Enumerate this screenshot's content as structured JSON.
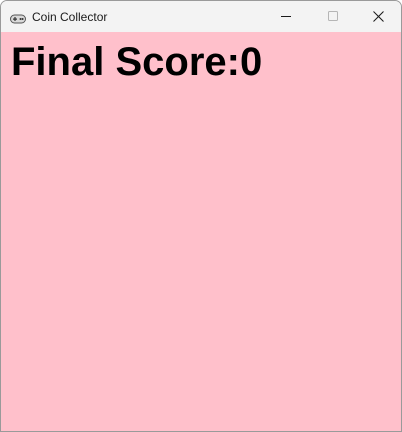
{
  "window": {
    "title": "Coin Collector",
    "app_icon": "gamepad-icon",
    "controls": {
      "minimize": "minimize-icon",
      "maximize": "maximize-icon",
      "close": "close-icon"
    }
  },
  "game": {
    "background_color": "#ffc0cb",
    "score_label": "Final Score:",
    "score_value": "0"
  }
}
